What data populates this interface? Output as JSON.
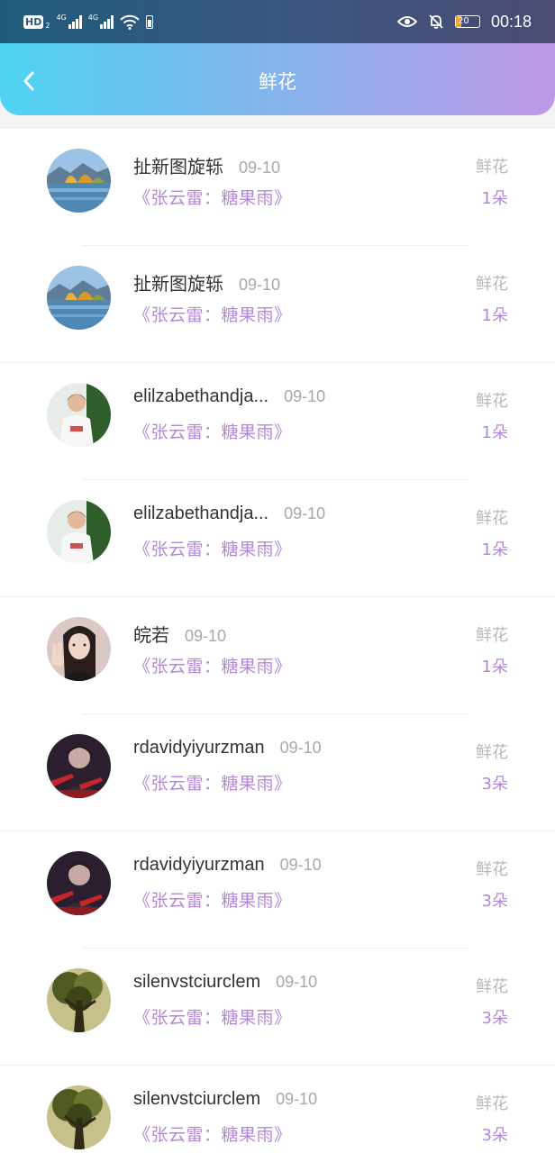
{
  "status_bar": {
    "hd_label": "HD",
    "hd_sub": "2",
    "net1": "4G",
    "net2": "4G",
    "battery_level": "20",
    "time": "00:18"
  },
  "header": {
    "title": "鲜花"
  },
  "records": [
    {
      "username": "扯新图旋轹",
      "date": "09-10",
      "book": "《张云雷：糖果雨》",
      "gift_type": "鲜花",
      "count": "1朵",
      "avatar": "lake-landscape"
    },
    {
      "username": "扯新图旋轹",
      "date": "09-10",
      "book": "《张云雷：糖果雨》",
      "gift_type": "鲜花",
      "count": "1朵",
      "avatar": "lake-landscape"
    },
    {
      "username": "elilzabethandja...",
      "date": "09-10",
      "book": "《张云雷：糖果雨》",
      "gift_type": "鲜花",
      "count": "1朵",
      "avatar": "boy-white-shirt"
    },
    {
      "username": "elilzabethandja...",
      "date": "09-10",
      "book": "《张云雷：糖果雨》",
      "gift_type": "鲜花",
      "count": "1朵",
      "avatar": "boy-white-shirt"
    },
    {
      "username": "皖若",
      "date": "09-10",
      "book": "《张云雷：糖果雨》",
      "gift_type": "鲜花",
      "count": "1朵",
      "avatar": "girl-peace-sign"
    },
    {
      "username": "rdavidyiyurzman",
      "date": "09-10",
      "book": "《张云雷：糖果雨》",
      "gift_type": "鲜花",
      "count": "3朵",
      "avatar": "dark-red-portrait"
    },
    {
      "username": "rdavidyiyurzman",
      "date": "09-10",
      "book": "《张云雷：糖果雨》",
      "gift_type": "鲜花",
      "count": "3朵",
      "avatar": "dark-red-portrait"
    },
    {
      "username": "silenvstciurclem",
      "date": "09-10",
      "book": "《张云雷：糖果雨》",
      "gift_type": "鲜花",
      "count": "3朵",
      "avatar": "green-tree"
    },
    {
      "username": "silenvstciurclem",
      "date": "09-10",
      "book": "《张云雷：糖果雨》",
      "gift_type": "鲜花",
      "count": "3朵",
      "avatar": "green-tree"
    }
  ],
  "colors": {
    "header_gradient_start": "#4fd4f3",
    "header_gradient_end": "#bf98e8",
    "accent_purple": "#b487d9",
    "date_gray": "#a8a8a8"
  }
}
